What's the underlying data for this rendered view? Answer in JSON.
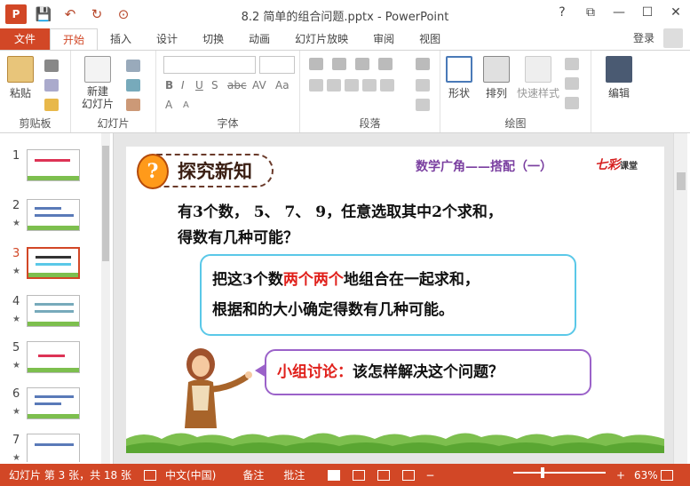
{
  "window": {
    "title": "8.2 简单的组合问题.pptx - PowerPoint",
    "app_icon": "P",
    "help": "?",
    "restore": "⧉",
    "minimize": "—",
    "maximize": "☐",
    "close": "✕"
  },
  "quick_access": {
    "save": "💾",
    "undo": "↶",
    "redo": "↻",
    "start": "⊙"
  },
  "tabs": [
    "文件",
    "开始",
    "插入",
    "设计",
    "切换",
    "动画",
    "幻灯片放映",
    "审阅",
    "视图"
  ],
  "login": "登录",
  "ribbon": {
    "clipboard": {
      "label": "剪贴板",
      "paste": "粘贴"
    },
    "slides": {
      "label": "幻灯片",
      "new_slide": "新建\n幻灯片"
    },
    "font": {
      "label": "字体",
      "bold": "B",
      "italic": "I",
      "underline": "U",
      "shadow": "S",
      "strike": "abc",
      "spacing": "AV",
      "case": "Aa",
      "size_up": "A",
      "size_down": "A"
    },
    "paragraph": {
      "label": "段落"
    },
    "drawing": {
      "label": "绘图",
      "shapes": "形状",
      "arrange": "排列",
      "quick_styles": "快速样式"
    },
    "editing": {
      "label": "编辑"
    }
  },
  "thumbnails": [
    {
      "number": "1",
      "star": ""
    },
    {
      "number": "2",
      "star": "★"
    },
    {
      "number": "3",
      "star": "★"
    },
    {
      "number": "4",
      "star": "★"
    },
    {
      "number": "5",
      "star": "★"
    },
    {
      "number": "6",
      "star": "★"
    },
    {
      "number": "7",
      "star": "★"
    }
  ],
  "slide": {
    "title": "探究新知",
    "subtitle": "数学广角——搭配（一）",
    "logo_main": "七彩",
    "logo_sub": "课堂",
    "question_line1": "有3个数，  5、  7、  9，任意选取其中2个求和，",
    "question_line2": "得数有几种可能？",
    "hint_pre": "把这3个数",
    "hint_red": "两个两个",
    "hint_post": "地组合在一起求和，",
    "hint_line2": "根据和的大小确定得数有几种可能。",
    "discuss_red": "小组讨论：",
    "discuss_text": "该怎样解决这个问题？"
  },
  "status": {
    "slide_info": "幻灯片 第 3 张，共 18 张",
    "language": "中文(中国)",
    "notes": "备注",
    "comments": "批注",
    "zoom": "63%",
    "zoom_value": 0.63,
    "minus": "−",
    "plus": "+"
  },
  "colors": {
    "accent": "#d24726",
    "hint_border": "#5ac8e8",
    "discuss_border": "#9b62c9",
    "red_text": "#e0201b"
  }
}
